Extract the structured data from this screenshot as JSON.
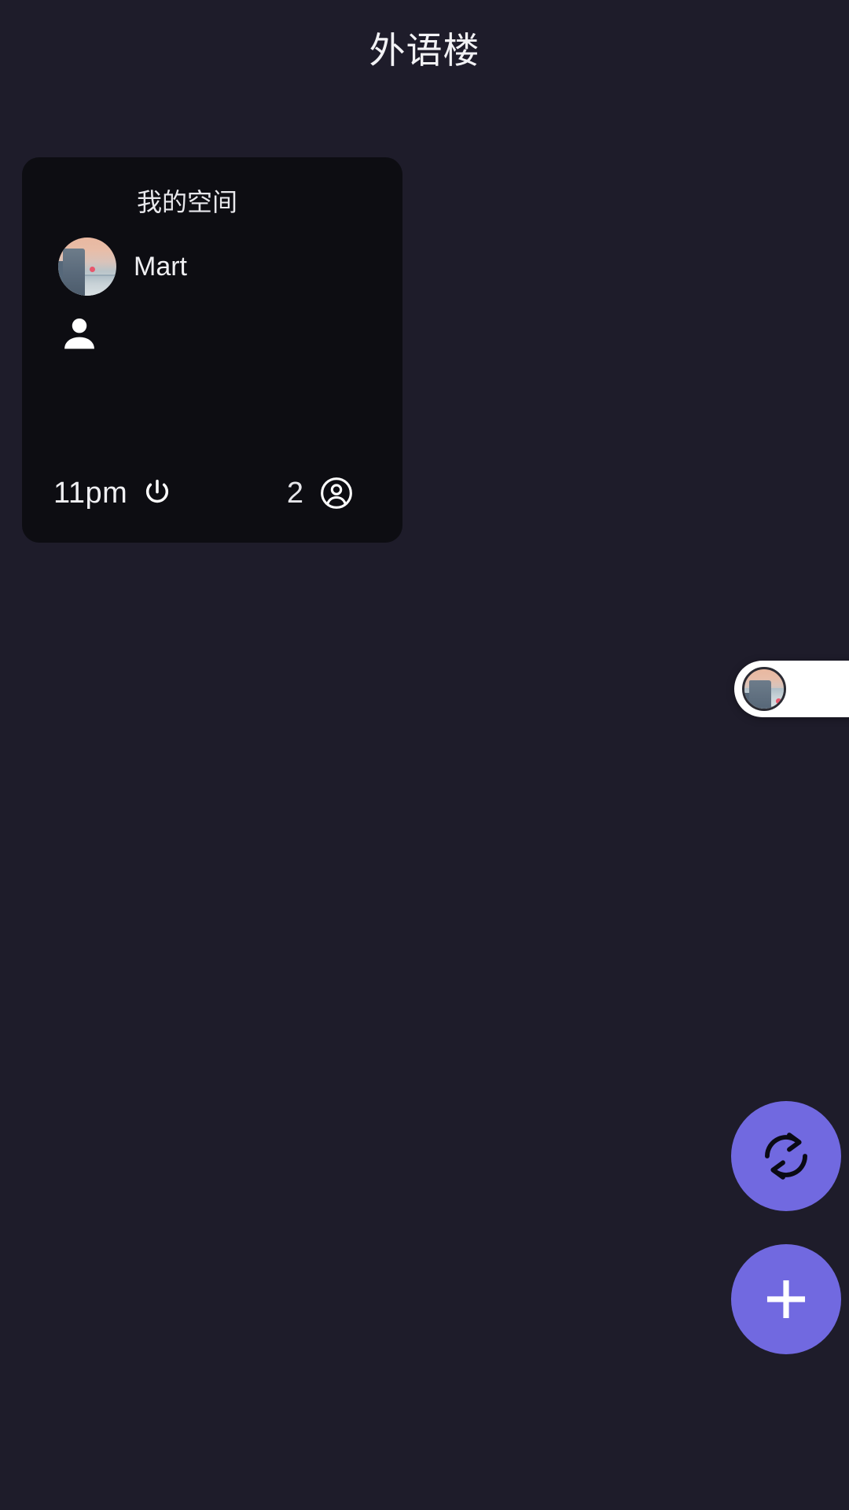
{
  "header": {
    "title": "外语楼"
  },
  "colors": {
    "background": "#1E1C2A",
    "card_background": "#0D0D12",
    "accent": "#7169E0",
    "text_primary": "#FFFFFF",
    "pill_background": "#FFFFFF"
  },
  "space_card": {
    "title": "我的空间",
    "member": {
      "name": "Mart",
      "avatar_icon": "sunset-photo-avatar"
    },
    "occupant_icon": "person-filled-icon",
    "footer": {
      "time": "11pm",
      "power_icon": "power-icon",
      "count": "2",
      "account_icon": "account-circle-icon"
    }
  },
  "avatar_pill": {
    "avatar_icon": "sunset-photo-avatar"
  },
  "fabs": [
    {
      "name": "refresh",
      "icon": "refresh-icon",
      "label": ""
    },
    {
      "name": "add",
      "icon": "plus-icon",
      "label": ""
    }
  ]
}
